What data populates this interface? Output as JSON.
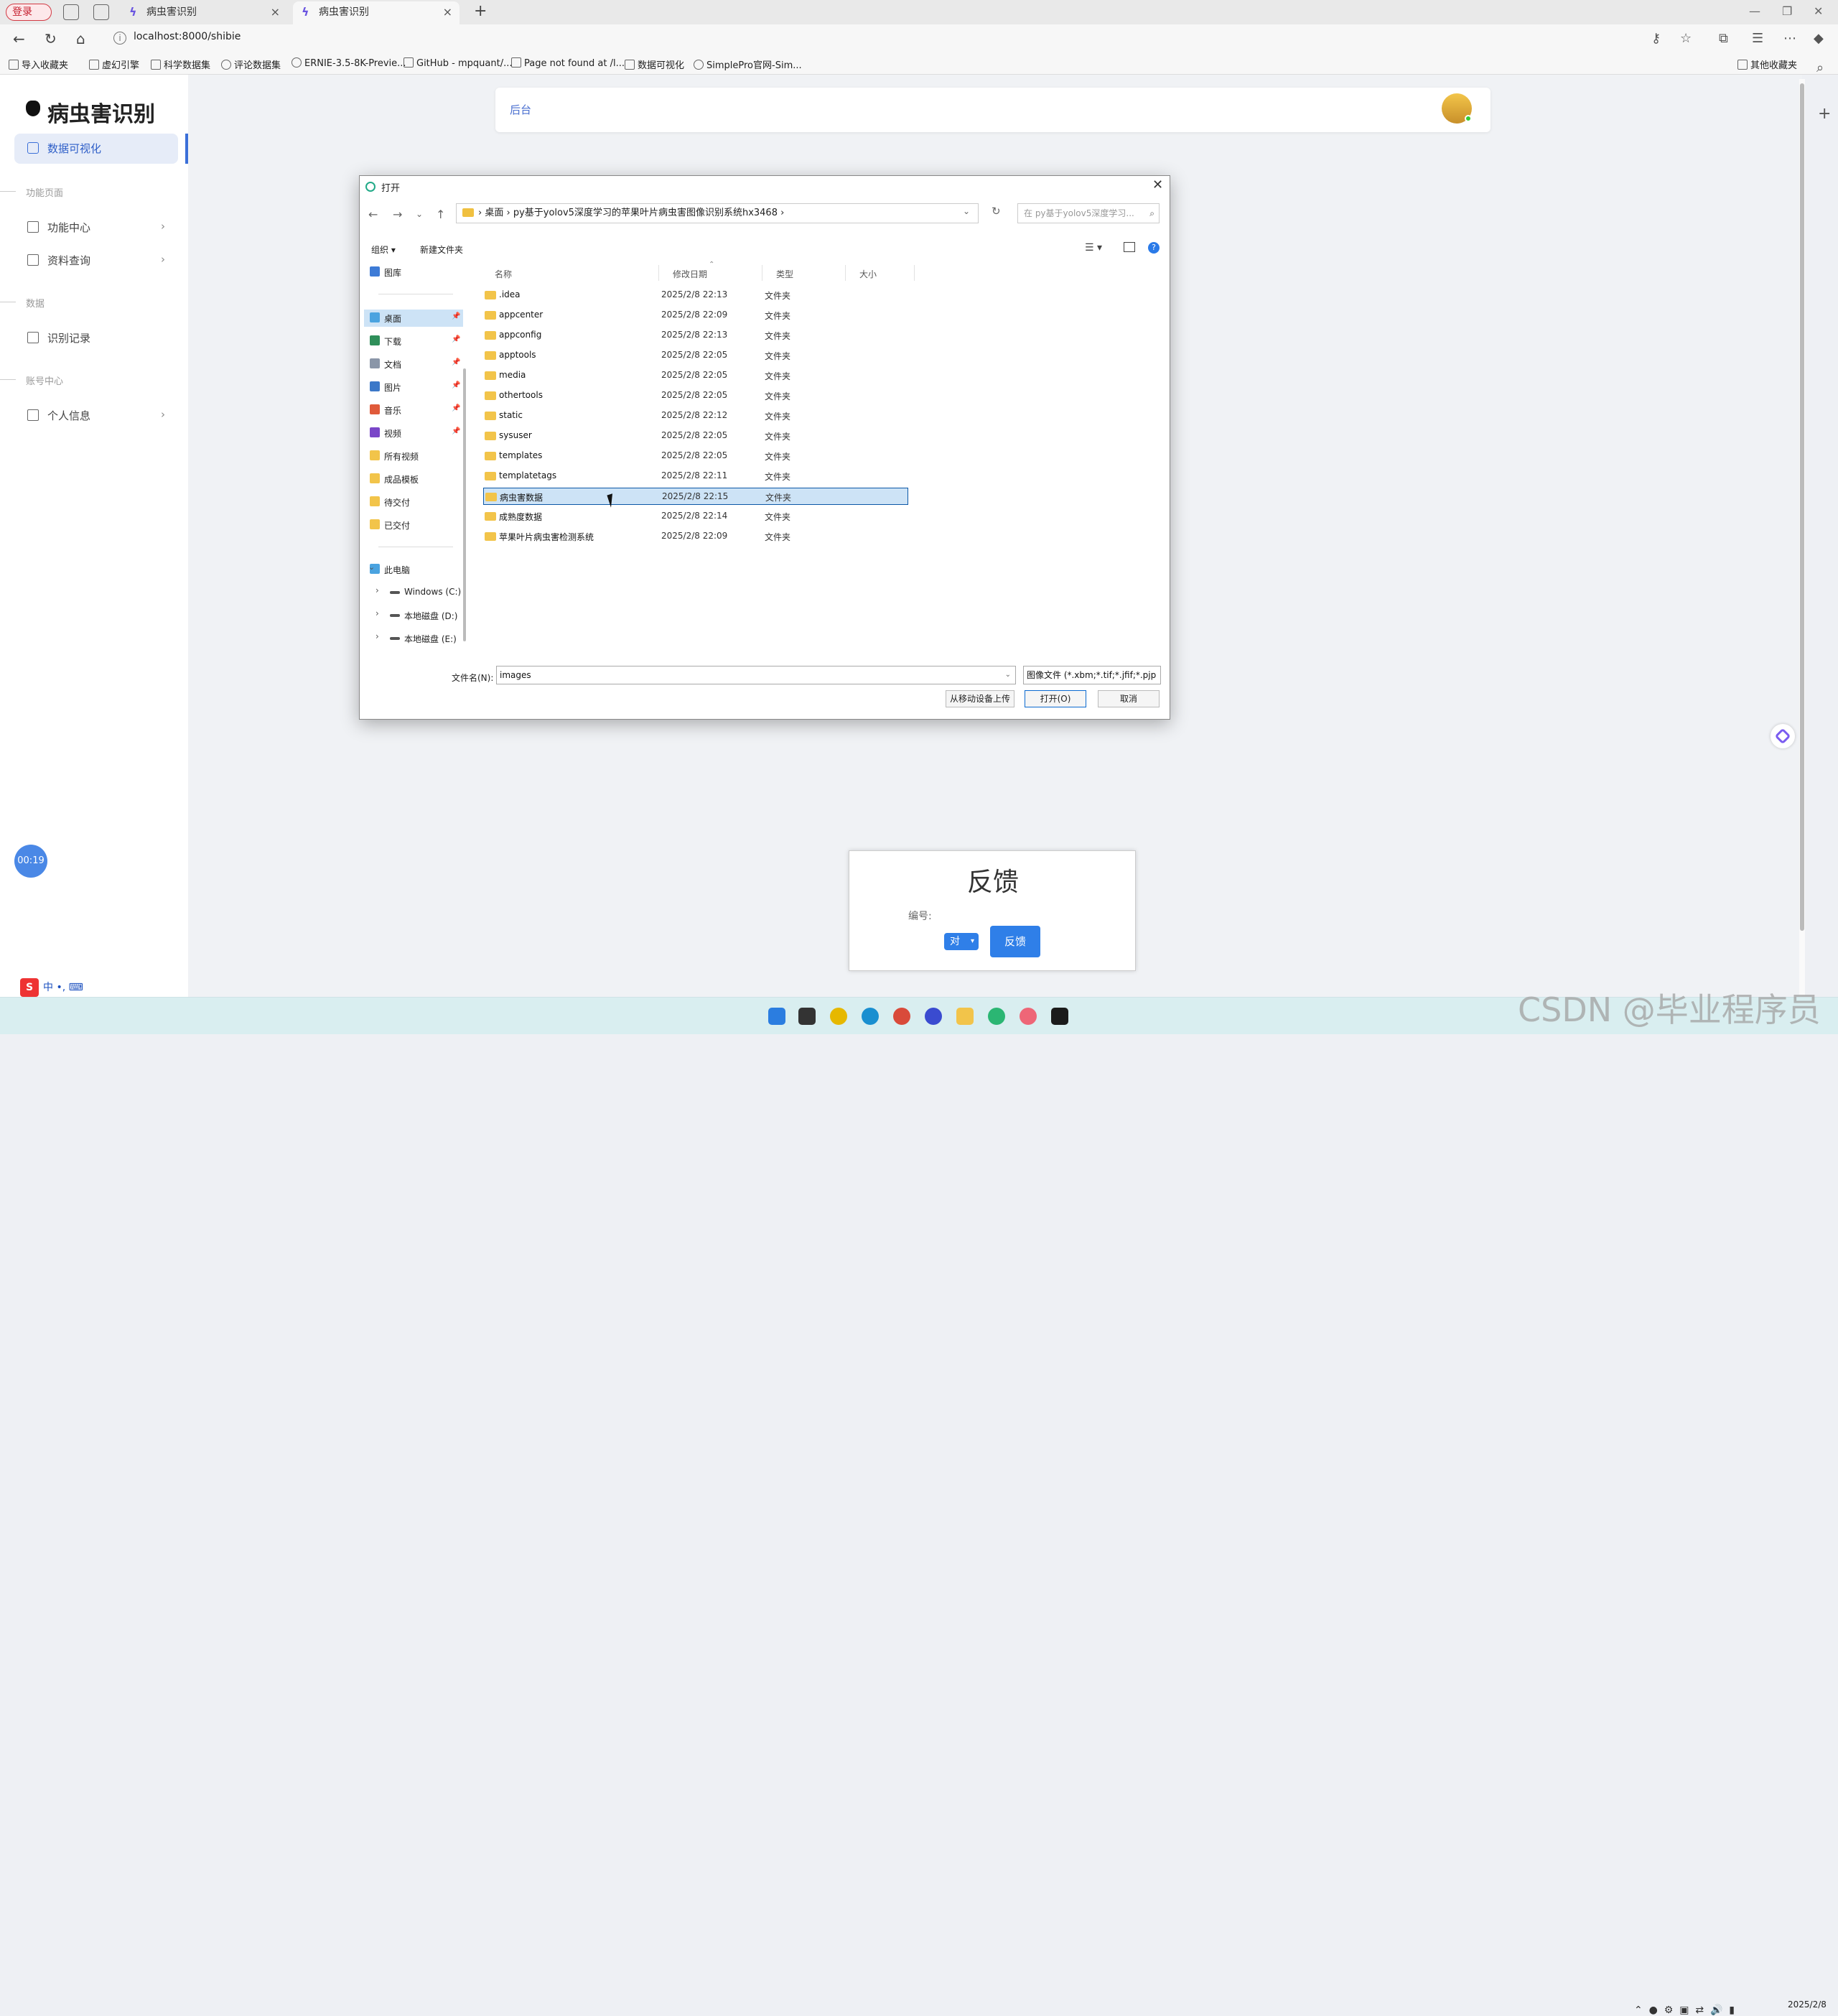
{
  "browser": {
    "login_badge": "登录",
    "tabs": [
      {
        "title": "病虫害识别",
        "active": false
      },
      {
        "title": "病虫害识别",
        "active": true
      }
    ],
    "url": "localhost:8000/shibie",
    "bookmarks": [
      "导入收藏夹",
      "虚幻引擎",
      "科学数据集",
      "评论数据集",
      "ERNIE-3.5-8K-Previe...",
      "GitHub - mpquant/...",
      "Page not found at /l...",
      "数据可视化",
      "SimplePro官网-Sim..."
    ],
    "other_bookmarks": "其他收藏夹"
  },
  "sidebar": {
    "brand": "病虫害识别",
    "active_item": "数据可视化",
    "sections": [
      {
        "title": "功能页面",
        "items": [
          {
            "label": "功能中心",
            "chevron": "›"
          },
          {
            "label": "资料查询",
            "chevron": "›"
          }
        ]
      },
      {
        "title": "数据",
        "items": [
          {
            "label": "识别记录",
            "chevron": ""
          }
        ]
      },
      {
        "title": "账号中心",
        "items": [
          {
            "label": "个人信息",
            "chevron": "›"
          }
        ]
      }
    ],
    "timer": "00:19",
    "ime": "中 •, ⌨"
  },
  "topcard": {
    "label": "后台"
  },
  "feedback": {
    "title": "反馈",
    "number_label": "编号:",
    "select_value": "对",
    "button_label": "反馈"
  },
  "dialog": {
    "title": "打开",
    "breadcrumb": [
      "桌面",
      "py基于yolov5深度学习的苹果叶片病虫害图像识别系统hx3468"
    ],
    "search_placeholder": "在 py基于yolov5深度学习...",
    "toolbar": {
      "organize": "组织 ▾",
      "new_folder": "新建文件夹"
    },
    "nav_pane": {
      "quick": [
        {
          "label": "图库",
          "icon": "gallery-icon",
          "color": "#3d7bd6",
          "pin": false
        },
        {
          "label": "桌面",
          "icon": "desktop-icon",
          "color": "#4aa3e0",
          "pin": true
        },
        {
          "label": "下载",
          "icon": "download-icon",
          "color": "#2f8f5a",
          "pin": true
        },
        {
          "label": "文档",
          "icon": "document-icon",
          "color": "#8a96a8",
          "pin": true
        },
        {
          "label": "图片",
          "icon": "picture-icon",
          "color": "#3b78c8",
          "pin": true
        },
        {
          "label": "音乐",
          "icon": "music-icon",
          "color": "#e05a3a",
          "pin": true
        },
        {
          "label": "视频",
          "icon": "video-icon",
          "color": "#7a46c8",
          "pin": true
        },
        {
          "label": "所有视频",
          "icon": "folder-icon",
          "color": "#f2c44a",
          "pin": false
        },
        {
          "label": "成品模板",
          "icon": "folder-icon",
          "color": "#f2c44a",
          "pin": false
        },
        {
          "label": "待交付",
          "icon": "folder-icon",
          "color": "#f2c44a",
          "pin": false
        },
        {
          "label": "已交付",
          "icon": "folder-icon",
          "color": "#f2c44a",
          "pin": false
        }
      ],
      "this_pc": "此电脑",
      "drives": [
        "Windows (C:)",
        "本地磁盘 (D:)",
        "本地磁盘 (E:)"
      ]
    },
    "columns": {
      "name": "名称",
      "date": "修改日期",
      "type": "类型",
      "size": "大小"
    },
    "files": [
      {
        "name": ".idea",
        "date": "2025/2/8 22:13",
        "type": "文件夹",
        "selected": false
      },
      {
        "name": "appcenter",
        "date": "2025/2/8 22:09",
        "type": "文件夹",
        "selected": false
      },
      {
        "name": "appconfig",
        "date": "2025/2/8 22:13",
        "type": "文件夹",
        "selected": false
      },
      {
        "name": "apptools",
        "date": "2025/2/8 22:05",
        "type": "文件夹",
        "selected": false
      },
      {
        "name": "media",
        "date": "2025/2/8 22:05",
        "type": "文件夹",
        "selected": false
      },
      {
        "name": "othertools",
        "date": "2025/2/8 22:05",
        "type": "文件夹",
        "selected": false
      },
      {
        "name": "static",
        "date": "2025/2/8 22:12",
        "type": "文件夹",
        "selected": false
      },
      {
        "name": "sysuser",
        "date": "2025/2/8 22:05",
        "type": "文件夹",
        "selected": false
      },
      {
        "name": "templates",
        "date": "2025/2/8 22:05",
        "type": "文件夹",
        "selected": false
      },
      {
        "name": "templatetags",
        "date": "2025/2/8 22:11",
        "type": "文件夹",
        "selected": false
      },
      {
        "name": "病虫害数据",
        "date": "2025/2/8 22:15",
        "type": "文件夹",
        "selected": true
      },
      {
        "name": "成熟度数据",
        "date": "2025/2/8 22:14",
        "type": "文件夹",
        "selected": false
      },
      {
        "name": "苹果叶片病虫害检测系统",
        "date": "2025/2/8 22:09",
        "type": "文件夹",
        "selected": false
      }
    ],
    "filename_label": "文件名(N):",
    "filename_value": "images",
    "filetype_value": "图像文件 (*.xbm;*.tif;*.jfif;*.pjp",
    "buttons": {
      "upload": "从移动设备上传",
      "open": "打开(O)",
      "cancel": "取消"
    }
  },
  "taskbar": {
    "watermark": "CSDN @毕业程序员",
    "clock_date": "2025/2/8"
  },
  "colors": {
    "accent": "#2f7fe8",
    "selection": "#cde3f6",
    "folder": "#f2c44a"
  }
}
